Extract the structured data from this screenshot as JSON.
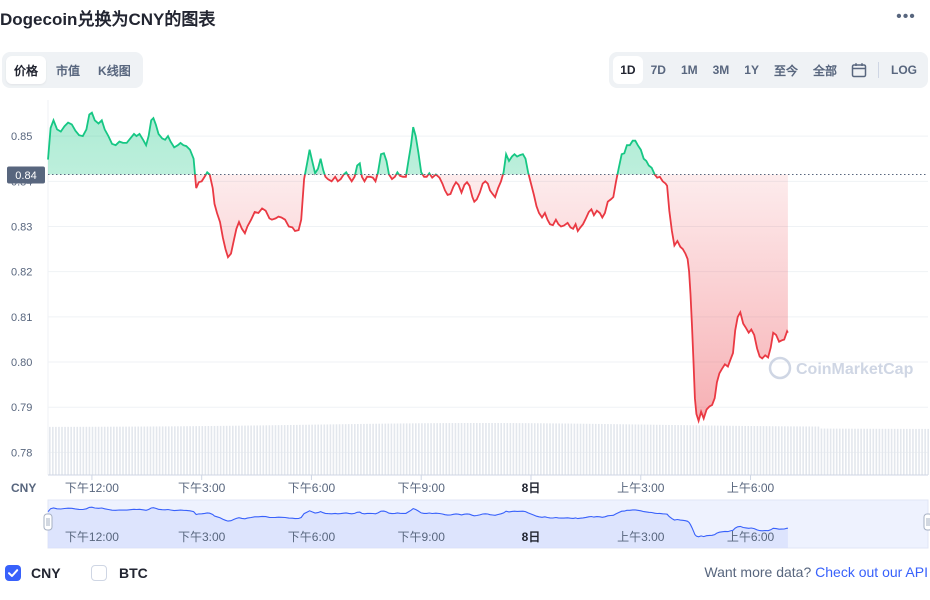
{
  "header": {
    "title": "Dogecoin兑换为CNY的图表",
    "more_label": "•••"
  },
  "left_tabs": [
    {
      "label": "价格",
      "active": true
    },
    {
      "label": "市值",
      "active": false
    },
    {
      "label": "K线图",
      "active": false
    }
  ],
  "range_tabs": [
    {
      "label": "1D",
      "active": true
    },
    {
      "label": "7D",
      "active": false
    },
    {
      "label": "1M",
      "active": false
    },
    {
      "label": "3M",
      "active": false
    },
    {
      "label": "1Y",
      "active": false
    },
    {
      "label": "至今",
      "active": false
    },
    {
      "label": "全部",
      "active": false
    }
  ],
  "log_label": "LOG",
  "chart_data": {
    "type": "area",
    "title": "",
    "xlabel": "",
    "ylabel": "",
    "currency_label": "CNY",
    "ylim": [
      0.775,
      0.858
    ],
    "yticks": [
      0.85,
      0.84,
      0.83,
      0.82,
      0.81,
      0.8,
      0.79,
      0.78
    ],
    "yticks_text": [
      "0.85",
      "0.84",
      "0.83",
      "0.82",
      "0.81",
      "0.80",
      "0.79",
      "0.78"
    ],
    "baseline": 0.8415,
    "baseline_label": "0.84",
    "xlim": [
      10.8,
      34.85
    ],
    "x_unit": "hours since 00:00 of the 7th",
    "xticks": [
      {
        "x": 12,
        "label": "下午12:00"
      },
      {
        "x": 15,
        "label": "下午3:00"
      },
      {
        "x": 18,
        "label": "下午6:00"
      },
      {
        "x": 21,
        "label": "下午9:00"
      },
      {
        "x": 24,
        "label": "8日"
      },
      {
        "x": 27,
        "label": "上午3:00"
      },
      {
        "x": 30,
        "label": "上午6:00"
      }
    ],
    "series": [
      {
        "points": [
          [
            10.8,
            0.8448
          ],
          [
            10.87,
            0.8518
          ],
          [
            10.95,
            0.8535
          ],
          [
            11.05,
            0.8515
          ],
          [
            11.15,
            0.851
          ],
          [
            11.25,
            0.8522
          ],
          [
            11.35,
            0.853
          ],
          [
            11.45,
            0.8526
          ],
          [
            11.55,
            0.8512
          ],
          [
            11.65,
            0.8502
          ],
          [
            11.75,
            0.85
          ],
          [
            11.85,
            0.8515
          ],
          [
            11.93,
            0.8548
          ],
          [
            12.0,
            0.8552
          ],
          [
            12.08,
            0.8535
          ],
          [
            12.18,
            0.8528
          ],
          [
            12.27,
            0.8535
          ],
          [
            12.35,
            0.8515
          ],
          [
            12.45,
            0.85
          ],
          [
            12.55,
            0.8483
          ],
          [
            12.65,
            0.848
          ],
          [
            12.75,
            0.8488
          ],
          [
            12.85,
            0.8485
          ],
          [
            12.95,
            0.8485
          ],
          [
            13.05,
            0.8495
          ],
          [
            13.15,
            0.8505
          ],
          [
            13.22,
            0.85
          ],
          [
            13.3,
            0.8505
          ],
          [
            13.4,
            0.8492
          ],
          [
            13.48,
            0.848
          ],
          [
            13.55,
            0.85
          ],
          [
            13.62,
            0.8535
          ],
          [
            13.68,
            0.854
          ],
          [
            13.75,
            0.8525
          ],
          [
            13.82,
            0.8505
          ],
          [
            13.92,
            0.8495
          ],
          [
            14.0,
            0.8492
          ],
          [
            14.08,
            0.85
          ],
          [
            14.15,
            0.8488
          ],
          [
            14.25,
            0.8475
          ],
          [
            14.35,
            0.848
          ],
          [
            14.42,
            0.8485
          ],
          [
            14.5,
            0.848
          ],
          [
            14.58,
            0.8478
          ],
          [
            14.68,
            0.847
          ],
          [
            14.78,
            0.845
          ],
          [
            14.85,
            0.8385
          ],
          [
            14.92,
            0.8398
          ],
          [
            15.0,
            0.84
          ],
          [
            15.08,
            0.841
          ],
          [
            15.15,
            0.842
          ],
          [
            15.22,
            0.8415
          ],
          [
            15.3,
            0.8385
          ],
          [
            15.35,
            0.835
          ],
          [
            15.42,
            0.833
          ],
          [
            15.5,
            0.831
          ],
          [
            15.58,
            0.8275
          ],
          [
            15.65,
            0.825
          ],
          [
            15.72,
            0.8232
          ],
          [
            15.8,
            0.824
          ],
          [
            15.88,
            0.827
          ],
          [
            15.95,
            0.8295
          ],
          [
            16.02,
            0.831
          ],
          [
            16.1,
            0.8295
          ],
          [
            16.18,
            0.8285
          ],
          [
            16.25,
            0.83
          ],
          [
            16.35,
            0.8315
          ],
          [
            16.45,
            0.8332
          ],
          [
            16.55,
            0.833
          ],
          [
            16.65,
            0.834
          ],
          [
            16.75,
            0.8335
          ],
          [
            16.85,
            0.8318
          ],
          [
            16.92,
            0.8315
          ],
          [
            17.02,
            0.8318
          ],
          [
            17.1,
            0.8322
          ],
          [
            17.18,
            0.832
          ],
          [
            17.28,
            0.8315
          ],
          [
            17.38,
            0.83
          ],
          [
            17.48,
            0.8298
          ],
          [
            17.55,
            0.829
          ],
          [
            17.65,
            0.8292
          ],
          [
            17.72,
            0.8315
          ],
          [
            17.8,
            0.8405
          ],
          [
            17.88,
            0.844
          ],
          [
            17.95,
            0.847
          ],
          [
            18.02,
            0.8445
          ],
          [
            18.1,
            0.8418
          ],
          [
            18.18,
            0.8428
          ],
          [
            18.25,
            0.845
          ],
          [
            18.32,
            0.8425
          ],
          [
            18.38,
            0.841
          ],
          [
            18.45,
            0.8405
          ],
          [
            18.55,
            0.84
          ],
          [
            18.65,
            0.841
          ],
          [
            18.72,
            0.84
          ],
          [
            18.8,
            0.8405
          ],
          [
            18.88,
            0.8415
          ],
          [
            18.95,
            0.842
          ],
          [
            19.02,
            0.841
          ],
          [
            19.1,
            0.84
          ],
          [
            19.18,
            0.841
          ],
          [
            19.25,
            0.8435
          ],
          [
            19.32,
            0.844
          ],
          [
            19.38,
            0.841
          ],
          [
            19.45,
            0.84
          ],
          [
            19.52,
            0.841
          ],
          [
            19.6,
            0.841
          ],
          [
            19.68,
            0.8408
          ],
          [
            19.75,
            0.84
          ],
          [
            19.82,
            0.842
          ],
          [
            19.9,
            0.846
          ],
          [
            19.98,
            0.8462
          ],
          [
            20.05,
            0.8445
          ],
          [
            20.12,
            0.8415
          ],
          [
            20.2,
            0.8405
          ],
          [
            20.28,
            0.841
          ],
          [
            20.35,
            0.842
          ],
          [
            20.42,
            0.8412
          ],
          [
            20.5,
            0.841
          ],
          [
            20.58,
            0.841
          ],
          [
            20.65,
            0.8445
          ],
          [
            20.72,
            0.848
          ],
          [
            20.78,
            0.852
          ],
          [
            20.85,
            0.85
          ],
          [
            20.92,
            0.8465
          ],
          [
            21.0,
            0.842
          ],
          [
            21.08,
            0.841
          ],
          [
            21.15,
            0.841
          ],
          [
            21.22,
            0.8418
          ],
          [
            21.3,
            0.8408
          ],
          [
            21.4,
            0.8415
          ],
          [
            21.5,
            0.8408
          ],
          [
            21.58,
            0.8395
          ],
          [
            21.65,
            0.838
          ],
          [
            21.72,
            0.837
          ],
          [
            21.8,
            0.8372
          ],
          [
            21.88,
            0.8388
          ],
          [
            21.95,
            0.8398
          ],
          [
            22.02,
            0.8392
          ],
          [
            22.1,
            0.8375
          ],
          [
            22.18,
            0.8392
          ],
          [
            22.25,
            0.8398
          ],
          [
            22.32,
            0.839
          ],
          [
            22.4,
            0.8365
          ],
          [
            22.45,
            0.8355
          ],
          [
            22.52,
            0.836
          ],
          [
            22.6,
            0.8375
          ],
          [
            22.68,
            0.8395
          ],
          [
            22.75,
            0.84
          ],
          [
            22.82,
            0.8395
          ],
          [
            22.88,
            0.838
          ],
          [
            22.95,
            0.8372
          ],
          [
            23.02,
            0.8365
          ],
          [
            23.1,
            0.8385
          ],
          [
            23.18,
            0.84
          ],
          [
            23.25,
            0.842
          ],
          [
            23.32,
            0.846
          ],
          [
            23.4,
            0.8445
          ],
          [
            23.48,
            0.8455
          ],
          [
            23.55,
            0.846
          ],
          [
            23.62,
            0.8455
          ],
          [
            23.7,
            0.8458
          ],
          [
            23.78,
            0.846
          ],
          [
            23.85,
            0.845
          ],
          [
            23.92,
            0.842
          ],
          [
            24.0,
            0.8395
          ],
          [
            24.08,
            0.837
          ],
          [
            24.15,
            0.8345
          ],
          [
            24.22,
            0.833
          ],
          [
            24.3,
            0.832
          ],
          [
            24.38,
            0.833
          ],
          [
            24.45,
            0.8315
          ],
          [
            24.52,
            0.8305
          ],
          [
            24.6,
            0.8303
          ],
          [
            24.68,
            0.8315
          ],
          [
            24.75,
            0.8305
          ],
          [
            24.82,
            0.83
          ],
          [
            24.9,
            0.8302
          ],
          [
            25.0,
            0.8308
          ],
          [
            25.08,
            0.8298
          ],
          [
            25.15,
            0.8295
          ],
          [
            25.22,
            0.8305
          ],
          [
            25.28,
            0.829
          ],
          [
            25.35,
            0.8298
          ],
          [
            25.42,
            0.8305
          ],
          [
            25.5,
            0.8318
          ],
          [
            25.58,
            0.8332
          ],
          [
            25.65,
            0.8338
          ],
          [
            25.72,
            0.8325
          ],
          [
            25.8,
            0.8335
          ],
          [
            25.88,
            0.833
          ],
          [
            25.95,
            0.832
          ],
          [
            26.02,
            0.833
          ],
          [
            26.1,
            0.8355
          ],
          [
            26.18,
            0.836
          ],
          [
            26.25,
            0.8365
          ],
          [
            26.32,
            0.8398
          ],
          [
            26.4,
            0.843
          ],
          [
            26.48,
            0.846
          ],
          [
            26.55,
            0.8462
          ],
          [
            26.62,
            0.848
          ],
          [
            26.7,
            0.848
          ],
          [
            26.78,
            0.849
          ],
          [
            26.85,
            0.849
          ],
          [
            26.92,
            0.848
          ],
          [
            27.0,
            0.847
          ],
          [
            27.08,
            0.845
          ],
          [
            27.15,
            0.8445
          ],
          [
            27.22,
            0.8435
          ],
          [
            27.3,
            0.843
          ],
          [
            27.38,
            0.8415
          ],
          [
            27.45,
            0.8408
          ],
          [
            27.52,
            0.841
          ],
          [
            27.6,
            0.84
          ],
          [
            27.68,
            0.8395
          ],
          [
            27.72,
            0.839
          ],
          [
            27.78,
            0.8335
          ],
          [
            27.85,
            0.829
          ],
          [
            27.92,
            0.8258
          ],
          [
            28.0,
            0.8268
          ],
          [
            28.08,
            0.8255
          ],
          [
            28.15,
            0.825
          ],
          [
            28.22,
            0.824
          ],
          [
            28.28,
            0.8228
          ],
          [
            28.32,
            0.82
          ],
          [
            28.36,
            0.815
          ],
          [
            28.4,
            0.808
          ],
          [
            28.44,
            0.8
          ],
          [
            28.48,
            0.792
          ],
          [
            28.52,
            0.7885
          ],
          [
            28.58,
            0.787
          ],
          [
            28.65,
            0.789
          ],
          [
            28.72,
            0.7875
          ],
          [
            28.8,
            0.7895
          ],
          [
            28.88,
            0.7902
          ],
          [
            28.95,
            0.7905
          ],
          [
            29.02,
            0.792
          ],
          [
            29.08,
            0.7955
          ],
          [
            29.15,
            0.7975
          ],
          [
            29.22,
            0.7985
          ],
          [
            29.3,
            0.7995
          ],
          [
            29.38,
            0.799
          ],
          [
            29.45,
            0.8005
          ],
          [
            29.52,
            0.802
          ],
          [
            29.58,
            0.807
          ],
          [
            29.65,
            0.81
          ],
          [
            29.72,
            0.811
          ],
          [
            29.8,
            0.8085
          ],
          [
            29.88,
            0.8075
          ],
          [
            29.95,
            0.8065
          ],
          [
            30.02,
            0.8072
          ],
          [
            30.1,
            0.806
          ],
          [
            30.18,
            0.803
          ],
          [
            30.25,
            0.8012
          ],
          [
            30.32,
            0.8008
          ],
          [
            30.4,
            0.8015
          ],
          [
            30.48,
            0.801
          ],
          [
            30.55,
            0.8032
          ],
          [
            30.62,
            0.8065
          ],
          [
            30.7,
            0.806
          ],
          [
            30.78,
            0.8045
          ],
          [
            30.85,
            0.8048
          ],
          [
            30.92,
            0.805
          ],
          [
            31.0,
            0.8068
          ],
          [
            31.02,
            0.8065
          ]
        ]
      }
    ],
    "colors": {
      "up": "#16c784",
      "down": "#ea3943",
      "navigator": "#3861fb"
    }
  },
  "watermark": {
    "text": "CoinMarketCap"
  },
  "footer": {
    "options": [
      {
        "label": "CNY",
        "checked": true
      },
      {
        "label": "BTC",
        "checked": false
      }
    ],
    "api_prompt": "Want more data?",
    "api_link": "Check out our API"
  }
}
